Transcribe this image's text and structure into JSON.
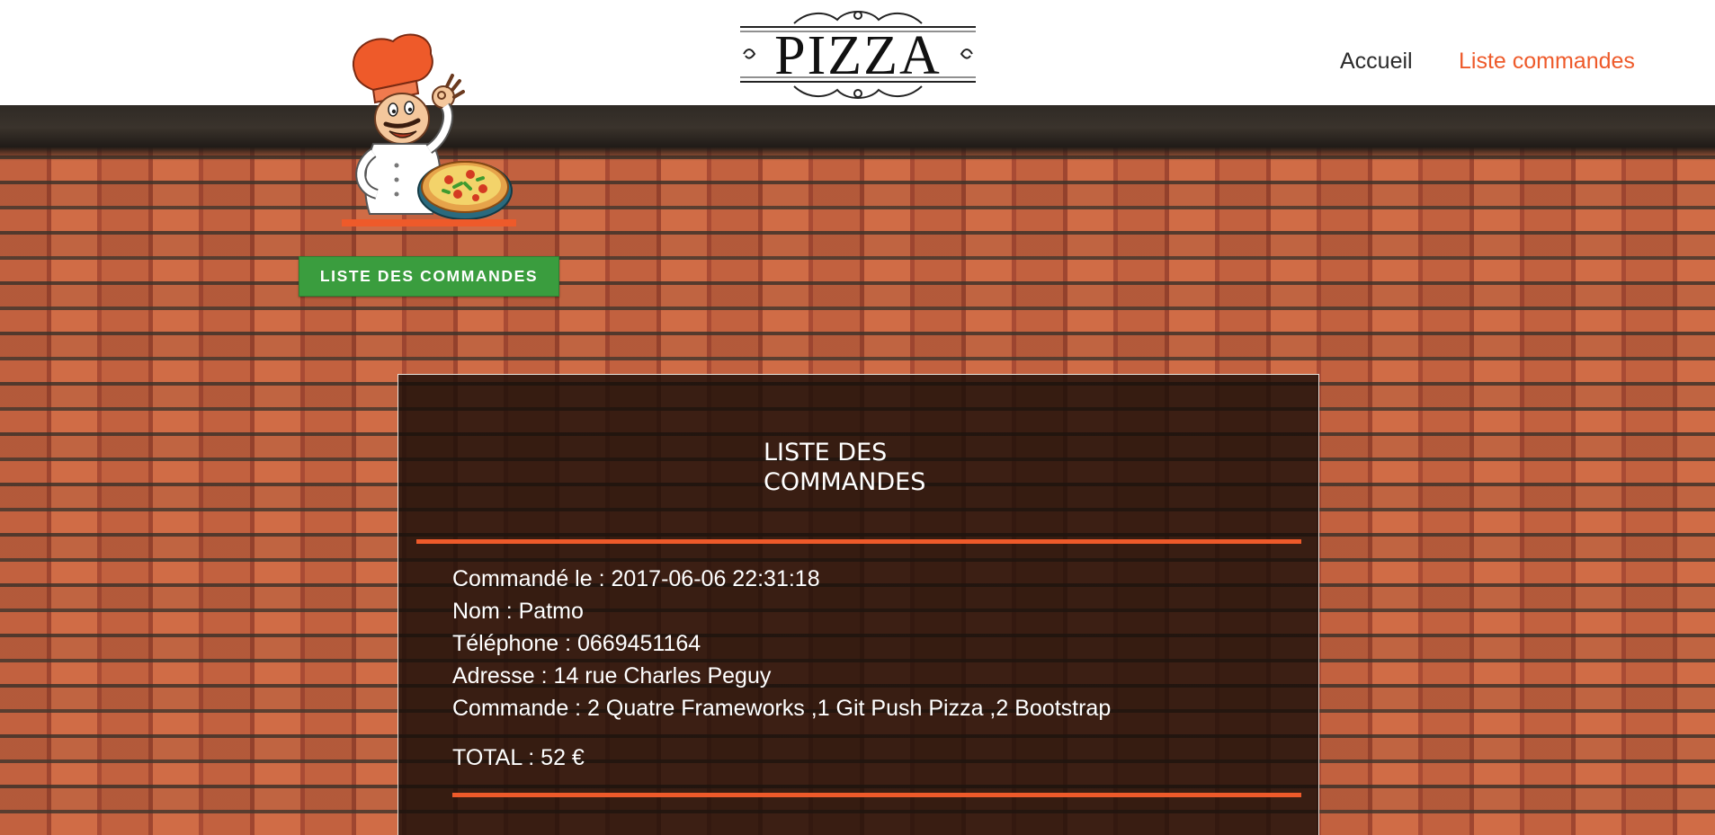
{
  "header": {
    "logo_text": "PIZZA",
    "nav": [
      {
        "label": "Accueil"
      },
      {
        "label": "Liste commandes"
      }
    ]
  },
  "hero": {
    "button_label": "LISTE DES COMMANDES"
  },
  "panel": {
    "title_line1": "LISTE DES",
    "title_line2": "COMMANDES",
    "order": {
      "date": "Commandé le : 2017-06-06 22:31:18",
      "name": "Nom : Patmo",
      "phone": "Téléphone : 0669451164",
      "address": "Adresse : 14 rue Charles Peguy",
      "items": "Commande : 2 Quatre Frameworks ,1 Git Push Pizza ,2 Bootstrap",
      "total": "TOTAL : 52 €"
    }
  },
  "colors": {
    "accent": "#ee5a2a",
    "button": "#3a9d3e",
    "nav_text": "#2b2b2b"
  },
  "icons": {
    "chef": "chef-mascot-icon",
    "logo": "pizza-logo-icon"
  }
}
